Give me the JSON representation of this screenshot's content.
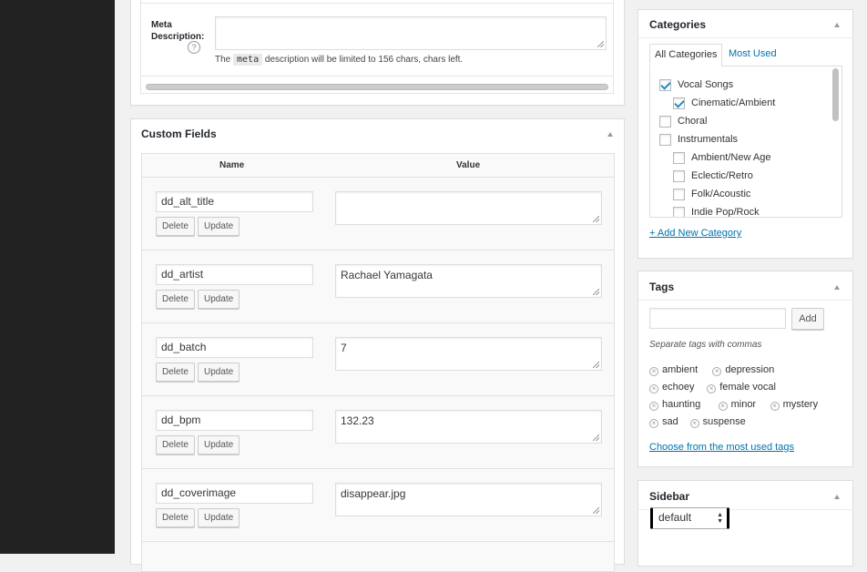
{
  "meta_box": {
    "label": "Meta Description:",
    "help_icon": "help-circle-icon",
    "note_prefix": "The",
    "note_code": "meta",
    "note_suffix": "description will be limited to 156 chars, chars left."
  },
  "custom_fields": {
    "title": "Custom Fields",
    "col_name": "Name",
    "col_value": "Value",
    "delete_label": "Delete",
    "update_label": "Update",
    "rows": [
      {
        "key": "dd_alt_title",
        "value": ""
      },
      {
        "key": "dd_artist",
        "value": "Rachael Yamagata"
      },
      {
        "key": "dd_batch",
        "value": "7"
      },
      {
        "key": "dd_bpm",
        "value": "132.23"
      },
      {
        "key": "dd_coverimage",
        "value": "disappear.jpg"
      }
    ]
  },
  "categories": {
    "title": "Categories",
    "tab_all": "All Categories",
    "tab_most_used": "Most Used",
    "items": [
      {
        "label": "Vocal Songs",
        "checked": true,
        "level": 0
      },
      {
        "label": "Cinematic/Ambient",
        "checked": true,
        "level": 1
      },
      {
        "label": "Choral",
        "checked": false,
        "level": 0
      },
      {
        "label": "Instrumentals",
        "checked": false,
        "level": 0
      },
      {
        "label": "Ambient/New Age",
        "checked": false,
        "level": 1
      },
      {
        "label": "Eclectic/Retro",
        "checked": false,
        "level": 1
      },
      {
        "label": "Folk/Acoustic",
        "checked": false,
        "level": 1
      },
      {
        "label": "Indie Pop/Rock",
        "checked": false,
        "level": 1
      }
    ],
    "add_new": "+ Add New Category"
  },
  "tags": {
    "title": "Tags",
    "add_label": "Add",
    "hint": "Separate tags with commas",
    "items": [
      "ambient",
      "depression",
      "echoey",
      "female vocal",
      "haunting",
      "minor",
      "mystery",
      "sad",
      "suspense"
    ],
    "choose_link": "Choose from the most used tags"
  },
  "sidebar": {
    "title": "Sidebar",
    "selected": "default"
  },
  "colors": {
    "accent": "#0073aa",
    "admin_bar": "#222222",
    "background": "#f1f1f1"
  }
}
